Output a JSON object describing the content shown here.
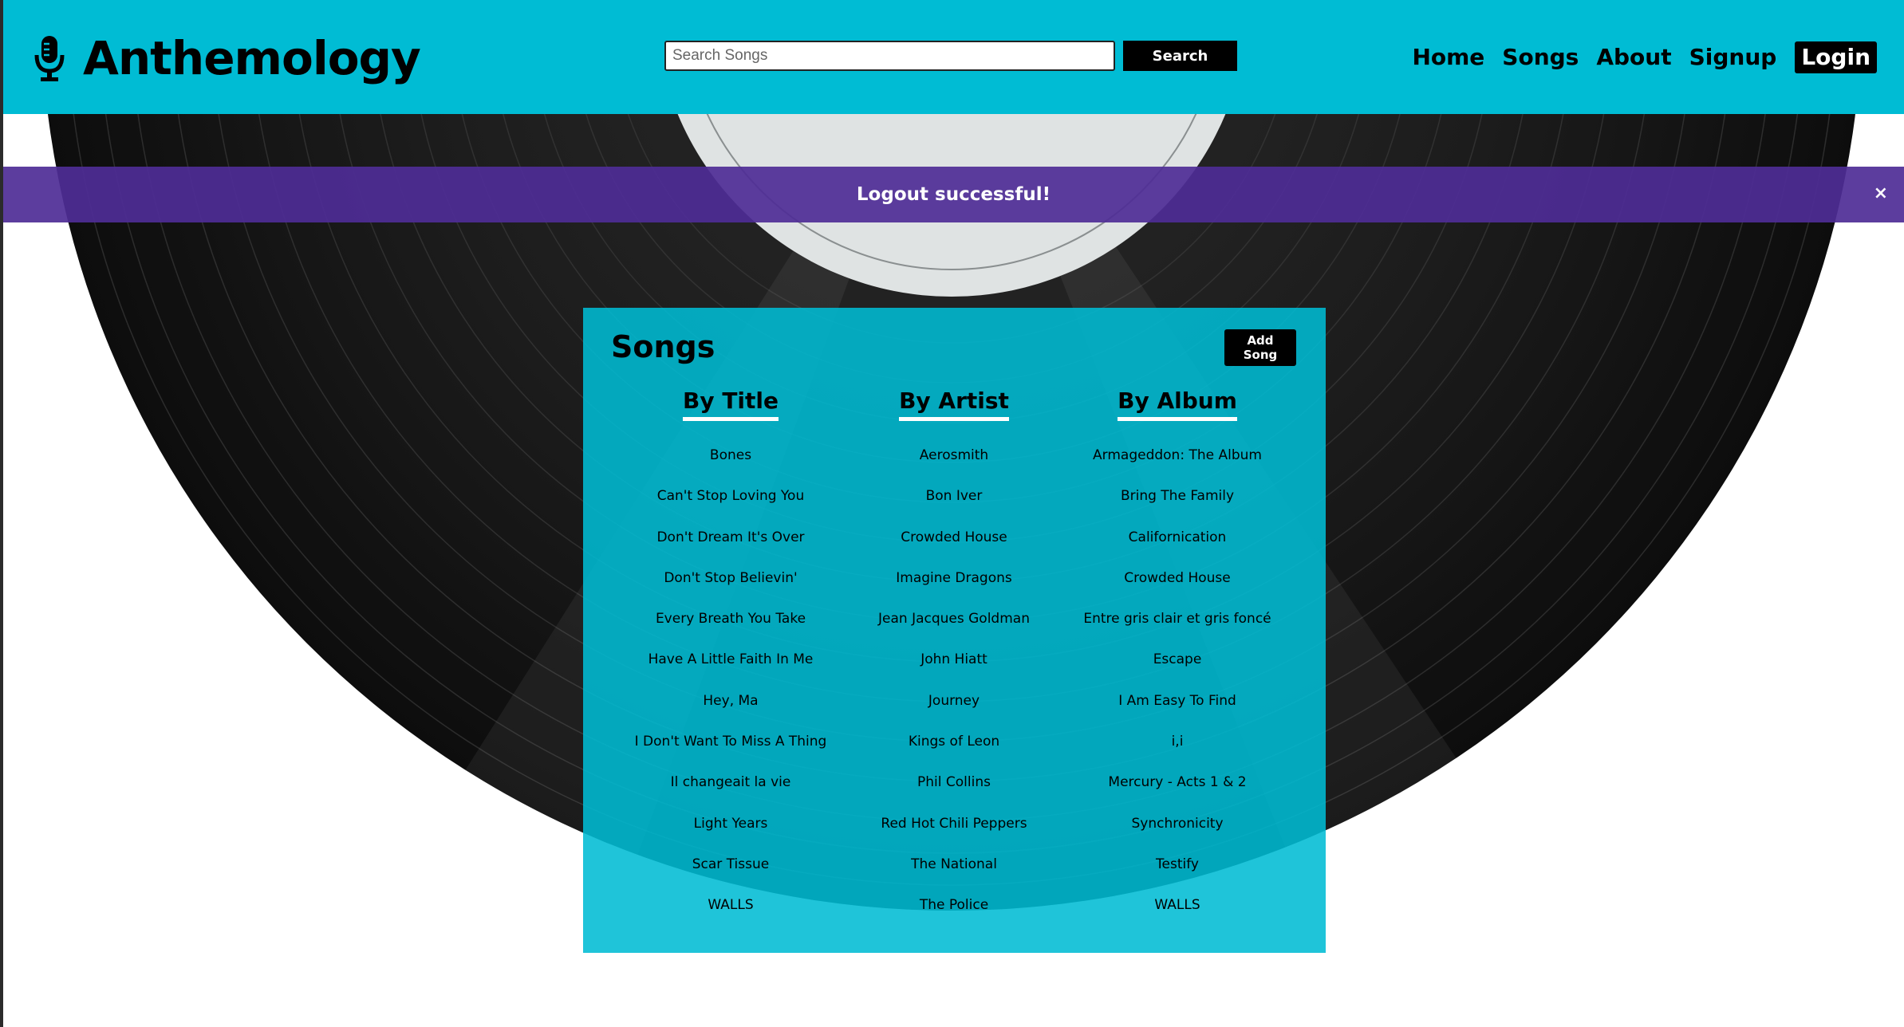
{
  "brand": {
    "name": "Anthemology",
    "icon": "microphone-icon"
  },
  "search": {
    "placeholder": "Search Songs",
    "value": "",
    "button_label": "Search"
  },
  "nav": {
    "items": [
      {
        "label": "Home"
      },
      {
        "label": "Songs"
      },
      {
        "label": "About"
      },
      {
        "label": "Signup"
      },
      {
        "label": "Login"
      }
    ]
  },
  "flash": {
    "message": "Logout successful!",
    "close_label": "×"
  },
  "songs": {
    "title": "Songs",
    "add_label": "Add Song",
    "columns": [
      {
        "heading": "By Title",
        "items": [
          "Bones",
          "Can't Stop Loving You",
          "Don't Dream It's Over",
          "Don't Stop Believin'",
          "Every Breath You Take",
          "Have A Little Faith In Me",
          "Hey, Ma",
          "I Don't Want To Miss A Thing",
          "Il changeait la vie",
          "Light Years",
          "Scar Tissue",
          "WALLS"
        ]
      },
      {
        "heading": "By Artist",
        "items": [
          "Aerosmith",
          "Bon Iver",
          "Crowded House",
          "Imagine Dragons",
          "Jean Jacques Goldman",
          "John Hiatt",
          "Journey",
          "Kings of Leon",
          "Phil Collins",
          "Red Hot Chili Peppers",
          "The National",
          "The Police"
        ]
      },
      {
        "heading": "By Album",
        "items": [
          "Armageddon: The Album",
          "Bring The Family",
          "Californication",
          "Crowded House",
          "Entre gris clair et gris foncé",
          "Escape",
          "I Am Easy To Find",
          "i,i",
          "Mercury - Acts 1 & 2",
          "Synchronicity",
          "Testify",
          "WALLS"
        ]
      }
    ]
  },
  "colors": {
    "navbar": "#00bcd4",
    "flash": "#4e2d96",
    "card": "#00bcd4",
    "button": "#000000",
    "underline": "#ffffff"
  }
}
